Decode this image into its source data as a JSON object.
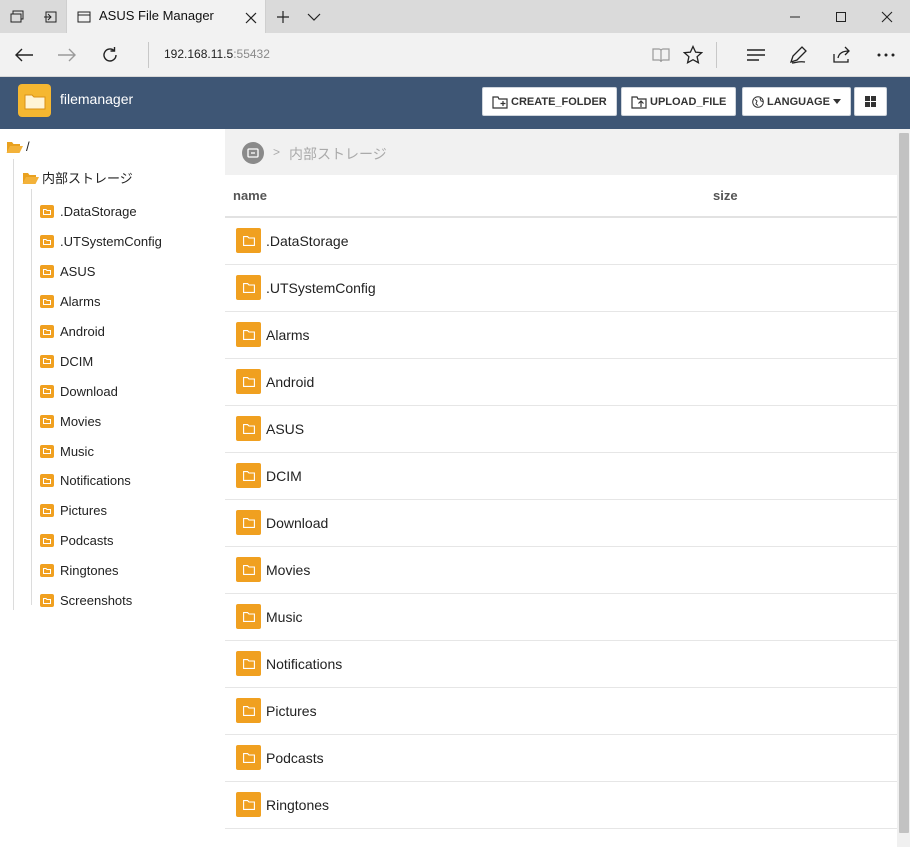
{
  "browser": {
    "tab_title": "ASUS File Manager",
    "address_host": "192.168.11.5",
    "address_port": ":55432"
  },
  "header": {
    "app_title": "filemanager",
    "buttons": {
      "create_folder": "CREATE_FOLDER",
      "upload_file": "UPLOAD_FILE",
      "language": "LANGUAGE"
    }
  },
  "sidebar": {
    "root": "/",
    "storage": "内部ストレージ",
    "items": [
      {
        "label": ".DataStorage"
      },
      {
        "label": ".UTSystemConfig"
      },
      {
        "label": "ASUS"
      },
      {
        "label": "Alarms"
      },
      {
        "label": "Android"
      },
      {
        "label": "DCIM"
      },
      {
        "label": "Download"
      },
      {
        "label": "Movies"
      },
      {
        "label": "Music"
      },
      {
        "label": "Notifications"
      },
      {
        "label": "Pictures"
      },
      {
        "label": "Podcasts"
      },
      {
        "label": "Ringtones"
      },
      {
        "label": "Screenshots"
      }
    ]
  },
  "main": {
    "breadcrumb_sep": ">",
    "breadcrumb_current": "内部ストレージ",
    "columns": {
      "name": "name",
      "size": "size"
    },
    "rows": [
      {
        "name": ".DataStorage"
      },
      {
        "name": ".UTSystemConfig"
      },
      {
        "name": "Alarms"
      },
      {
        "name": "Android"
      },
      {
        "name": "ASUS"
      },
      {
        "name": "DCIM"
      },
      {
        "name": "Download"
      },
      {
        "name": "Movies"
      },
      {
        "name": "Music"
      },
      {
        "name": "Notifications"
      },
      {
        "name": "Pictures"
      },
      {
        "name": "Podcasts"
      },
      {
        "name": "Ringtones"
      }
    ]
  },
  "colors": {
    "header_bg": "#3e5675",
    "folder": "#f0a020",
    "logo": "#f5b731"
  }
}
